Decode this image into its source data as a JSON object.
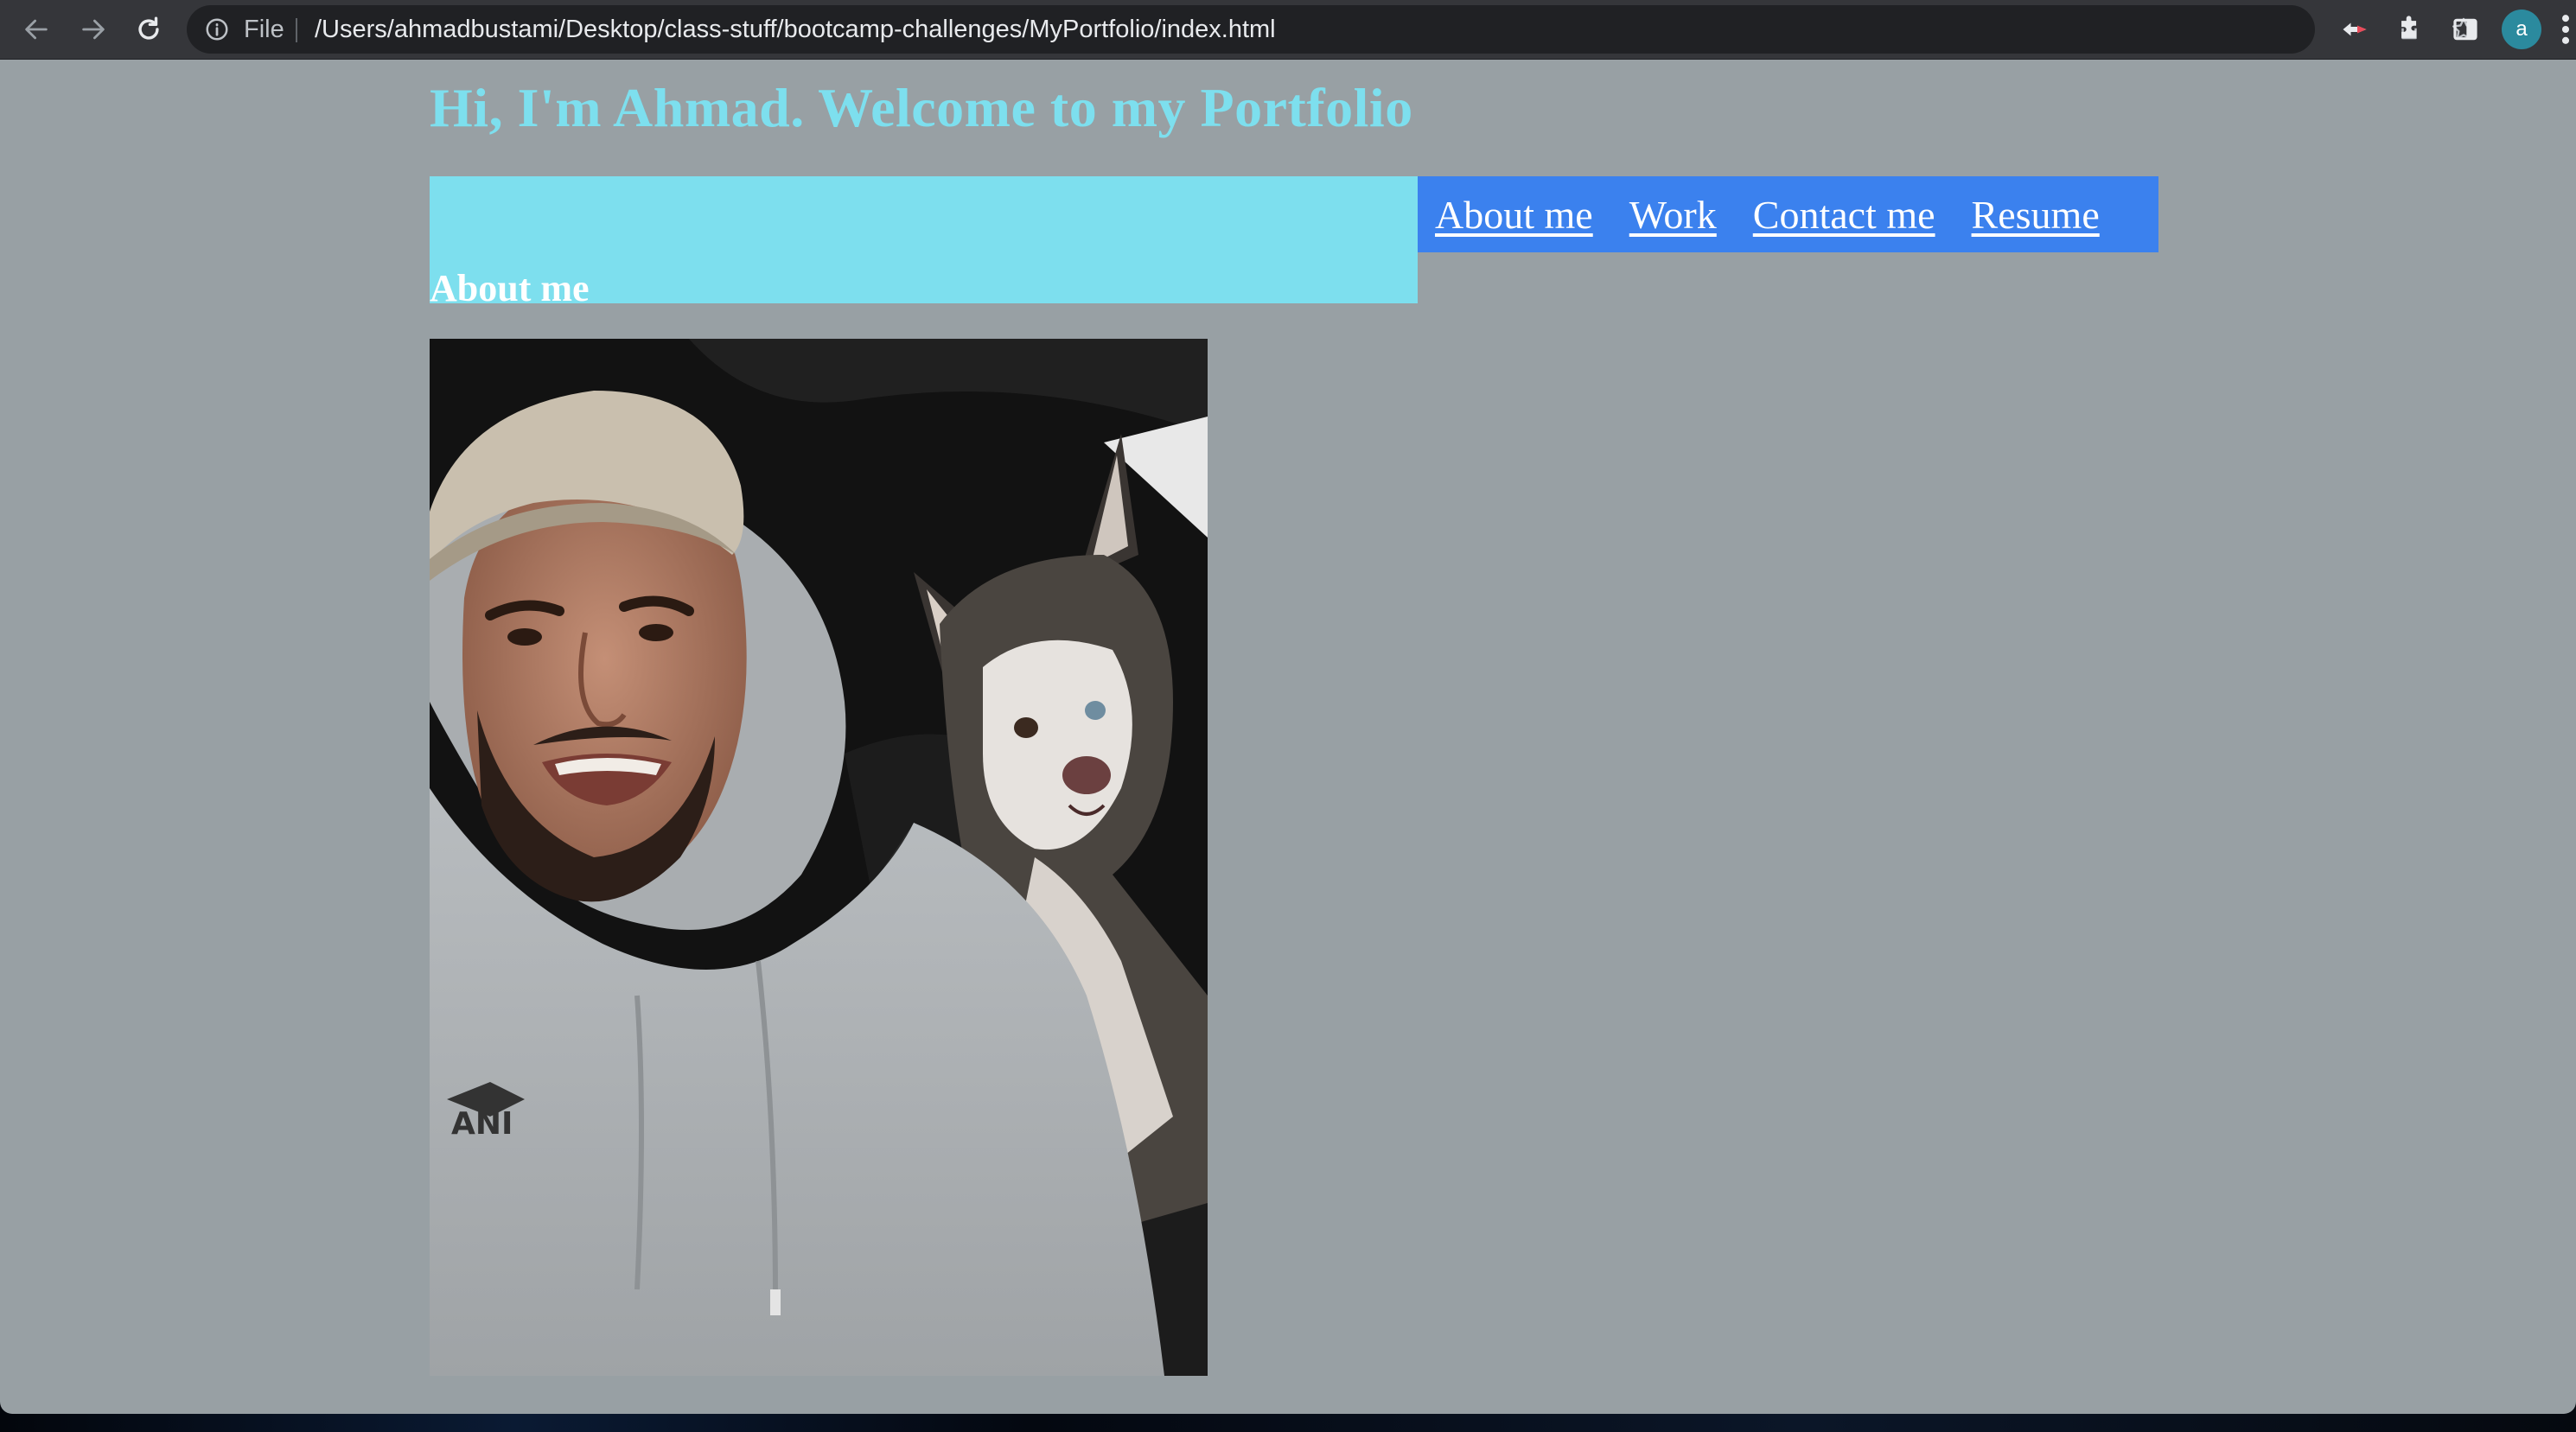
{
  "browser": {
    "file_label": "File",
    "url": "/Users/ahmadbustami/Desktop/class-stuff/bootcamp-challenges/MyPortfolio/index.html",
    "profile_initial": "a",
    "icons": [
      "back-arrow-icon",
      "forward-arrow-icon",
      "reload-icon",
      "info-icon",
      "share-icon",
      "star-icon",
      "extension-icon",
      "puzzle-icon",
      "side-panel-icon",
      "menu-icon"
    ]
  },
  "page": {
    "title": "Hi, I'm Ahmad. Welcome to my Portfolio",
    "section_heading": "About me",
    "nav": [
      "About me",
      "Work",
      "Contact me",
      "Resume"
    ],
    "colors": {
      "background": "#98a0a4",
      "accent_cyan": "#7ddfee",
      "nav_blue": "#3b81ee"
    }
  }
}
